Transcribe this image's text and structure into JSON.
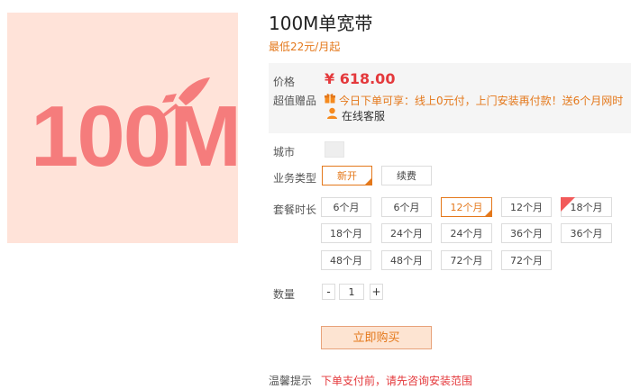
{
  "product": {
    "hero_text": "100M",
    "title": "100M单宽带",
    "subtitle": "最低22元/月起",
    "colors": {
      "accent": "#e4781b",
      "price": "#e4393c",
      "hero_bg": "#ffe3d9",
      "hero_fg": "#f57c7c"
    }
  },
  "info": {
    "price_label": "价格",
    "price": "¥ 618.00",
    "gift_label": "超值赠品",
    "promo": "今日下单可享：线上0元付，上门安装再付款！送6个月网时",
    "service": "在线客服"
  },
  "city": {
    "label": "城市"
  },
  "business": {
    "label": "业务类型",
    "options": [
      "新开",
      "续费"
    ],
    "selected": "新开"
  },
  "package": {
    "label": "套餐时长",
    "options": [
      "6个月",
      "6个月",
      "12个月",
      "12个月",
      "18个月",
      "18个月",
      "24个月",
      "24个月",
      "36个月",
      "36个月",
      "48个月",
      "48个月",
      "72个月",
      "72个月"
    ],
    "selected_index": 2,
    "hot_index": 4
  },
  "quantity": {
    "label": "数量",
    "minus": "-",
    "value": "1",
    "plus": "+"
  },
  "buy_button": "立即购买",
  "tip": {
    "label": "温馨提示",
    "text": "下单支付前，请先咨询安装范围"
  }
}
